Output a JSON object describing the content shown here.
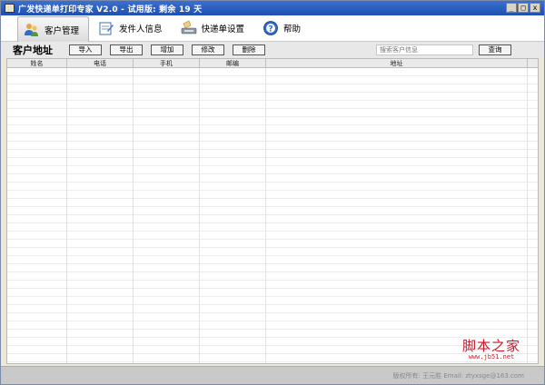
{
  "window": {
    "title": "广发快递单打印专家 V2.0 - 试用版: 剩余 19 天",
    "minimize_label": "_",
    "maximize_label": "□",
    "close_label": "x"
  },
  "toolbar": {
    "items": [
      {
        "label": "客户管理",
        "icon": "customers-icon"
      },
      {
        "label": "发件人信息",
        "icon": "sender-info-icon"
      },
      {
        "label": "快递单设置",
        "icon": "waybill-settings-icon"
      },
      {
        "label": "帮助",
        "icon": "help-icon"
      }
    ]
  },
  "actions": {
    "section_title": "客户地址",
    "import_label": "导入",
    "export_label": "导出",
    "add_label": "增加",
    "edit_label": "修改",
    "delete_label": "删除",
    "search_placeholder": "搜索客户信息",
    "search_label": "查询"
  },
  "table": {
    "columns": [
      "姓名",
      "电话",
      "手机",
      "邮编",
      "地址"
    ],
    "rows": []
  },
  "status": {
    "text": "版权所有: 王元胜  Email: ztyxsge@163.com"
  },
  "watermark": {
    "main": "脚本之家",
    "sub": "www.jb51.net"
  },
  "colors": {
    "titlebar": "#1f4fb0",
    "watermark": "#c8192a"
  }
}
